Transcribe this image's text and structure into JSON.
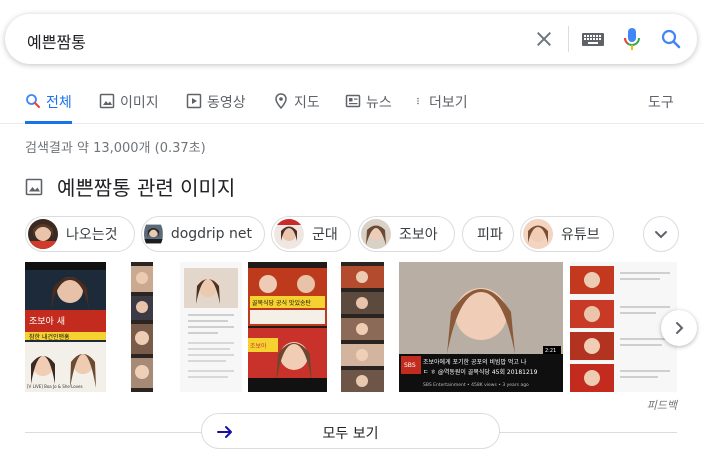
{
  "search": {
    "query": "예쁜짬통"
  },
  "tabs": [
    {
      "label": "전체",
      "icon": "search-icon",
      "active": true
    },
    {
      "label": "이미지",
      "icon": "image-icon"
    },
    {
      "label": "동영상",
      "icon": "video-icon"
    },
    {
      "label": "지도",
      "icon": "map-pin-icon"
    },
    {
      "label": "뉴스",
      "icon": "news-icon"
    },
    {
      "label": "더보기",
      "icon": "more-vert-icon"
    }
  ],
  "tools_label": "도구",
  "result_stats": "검색결과 약 13,000개 (0.37초)",
  "images_section": {
    "title": "예쁜짬통 관련 이미지",
    "chips": [
      "나오는것",
      "dogdrip net",
      "군대",
      "조보아",
      "피파",
      "유튜브"
    ],
    "tiles": [
      {
        "caption_top": "조보아 새",
        "caption_mid": "참한 내건인맨훔",
        "caption_bot": "[V LIVE] Boa Jo & She Loves"
      },
      {
        "caption_top": ""
      },
      {
        "caption_top": ""
      },
      {
        "caption_top": "골목식당 공식 맛있송탄",
        "caption_mid": "조보아"
      },
      {
        "caption_top": ""
      },
      {
        "caption_top": "조보아에게 포기한 공포의 비빔밥 먹고 나",
        "caption_mid": "ㄷ ㅎ @역동원이 골목식당 45회 20181219",
        "caption_bot": "SBS Entertainment • 458K views • 3 years ago",
        "duration": "2:21"
      },
      {
        "caption_top": ""
      }
    ],
    "feedback": "피드백",
    "see_all": "모두 보기"
  },
  "colors": {
    "accent": "#1a73e8",
    "google_red": "#ea4335",
    "google_yellow": "#fbbc04",
    "google_green": "#34a853"
  }
}
